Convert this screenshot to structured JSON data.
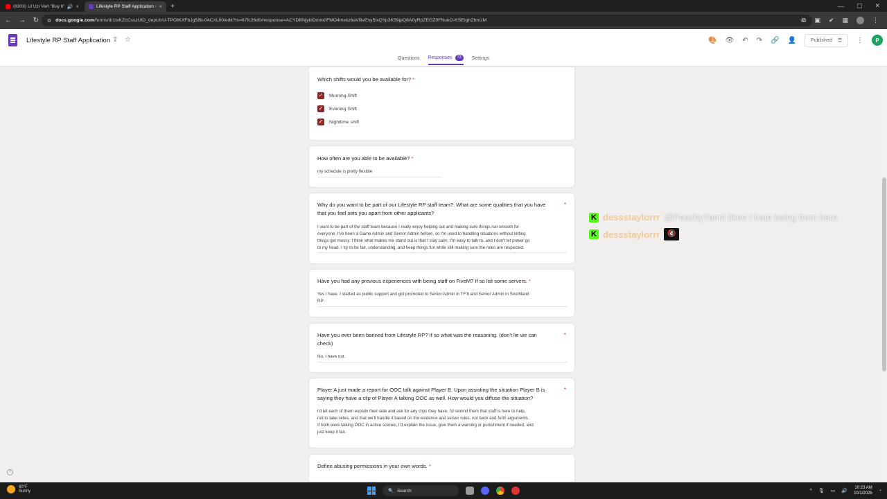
{
  "browser": {
    "tabs": [
      {
        "label": "(6303) Lil Uzi Vert \"Buy It\"",
        "active": false,
        "color": "#ff0000"
      },
      {
        "label": "Lifestyle RP Staff Application - G",
        "active": true,
        "color": "#673ab7"
      }
    ],
    "url_domain": "docs.google.com",
    "url_rest": "/forms/d/1txKZcCsszUlD_depUtrU-TPOtKXFbJg58b-04CXLlI0/edit?ts=67fc26d0#response=ACYDBNjykIDmm0FMO4mxkz6aVBvEny5IxQYp3K59jpQ8A0yRpZEGZ0FNukO-KSErghZbmJM"
  },
  "form": {
    "title": "Lifestyle RP Staff Application",
    "published_label": "Published",
    "avatar_letter": "P",
    "tabs": {
      "questions": "Questions",
      "responses": "Responses",
      "response_count": "73",
      "settings": "Settings"
    }
  },
  "questions": [
    {
      "title": "Which shifts would you be available for?",
      "options": [
        "Morning Shift",
        "Evening Shift",
        "Nighttime shift"
      ]
    },
    {
      "title": "How often are you able to be available?",
      "answer": "my schedule is pretty flexible"
    },
    {
      "title_line1": "Why do you want to be part of our Lifestyle RP staff team?. What are some qualities that you have",
      "title_line2": "that you feel sets you apart from other applicants?",
      "answer_lines": [
        "I want to be part of the staff team because I really enjoy helping out and making sure things run smooth for",
        "everyone. I've been a Game Admin and Senior Admin before, so I'm used to handling situations without letting",
        "things get messy. I think what makes me stand out is that I stay calm, I'm easy to talk to, and I don't let power go",
        "to my head. I try to be fair, understanding, and keep things fun while still making sure the rules are respected."
      ]
    },
    {
      "title": "Have you had any previous experiences with being staff on FiveM? If so list some servers.",
      "answer_lines": [
        "Yes I have. I started as public support and got promoted to Senior Admin in TF'b and Senior Admin in Southland",
        "RP"
      ]
    },
    {
      "title_line1": "Have you ever been banned from Lifestyle RP? If so what was the reasoning. (don't lie we can",
      "title_line2": "check)",
      "answer": "No, I have not."
    },
    {
      "title_line1": "Player A just made a report for OOC talk against Player B. Upon assisting the situation Player B is",
      "title_line2": "saying they have a clip of Player A talking OOC as well. How would you diffuse the situation?",
      "answer_lines": [
        "I'd let each of them explain their side and ask for any clips they have. I'd remind them that staff is here to help,",
        "not to take sides, and that we'll handle it based on the evidence and server rules, not back and forth arguments.",
        "If both were talking OOC in active scenes, I'd explain the issue, give them a warning or punishment if needed, and",
        "just keep it fair."
      ]
    },
    {
      "title": "Define abusing permissions in your own words."
    }
  ],
  "required_mark": "*",
  "chat": [
    {
      "badge": "K",
      "user": "dessstaylorrr",
      "message": "@PeachyYanni likee I hate being from here"
    },
    {
      "badge": "K",
      "user": "dessstaylorrr",
      "emote": "🔇"
    }
  ],
  "taskbar": {
    "temp": "60°F",
    "weather": "Sunny",
    "search": "Search",
    "time": "10:23 AM",
    "date": "10/1/2025"
  }
}
